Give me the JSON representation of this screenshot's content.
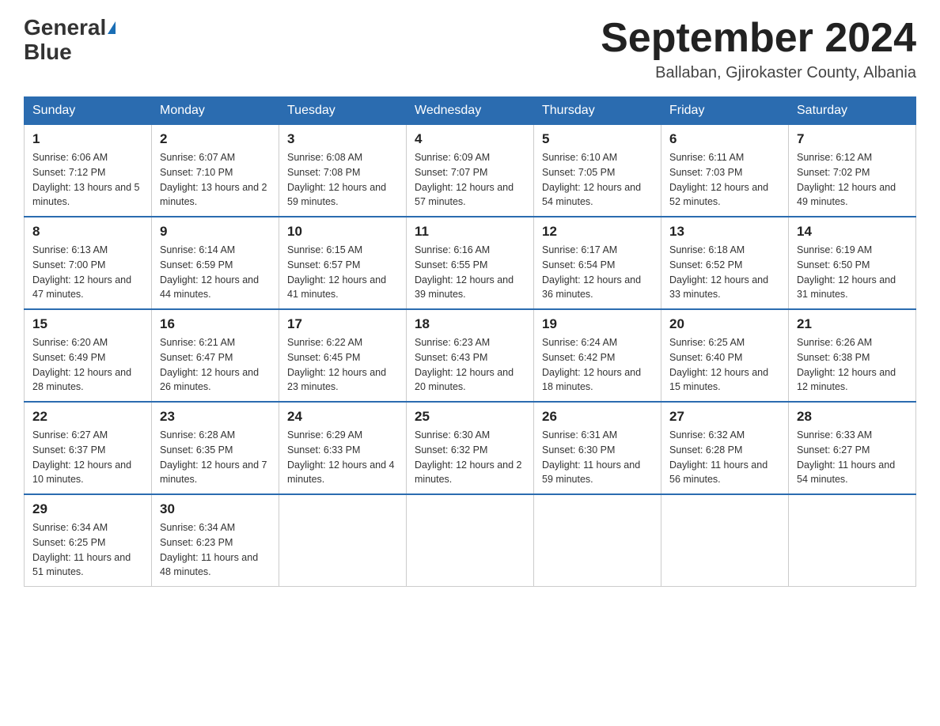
{
  "header": {
    "logo_general": "General",
    "logo_blue": "Blue",
    "title": "September 2024",
    "subtitle": "Ballaban, Gjirokaster County, Albania"
  },
  "days_of_week": [
    "Sunday",
    "Monday",
    "Tuesday",
    "Wednesday",
    "Thursday",
    "Friday",
    "Saturday"
  ],
  "weeks": [
    [
      {
        "day": "1",
        "sunrise": "6:06 AM",
        "sunset": "7:12 PM",
        "daylight": "13 hours and 5 minutes."
      },
      {
        "day": "2",
        "sunrise": "6:07 AM",
        "sunset": "7:10 PM",
        "daylight": "13 hours and 2 minutes."
      },
      {
        "day": "3",
        "sunrise": "6:08 AM",
        "sunset": "7:08 PM",
        "daylight": "12 hours and 59 minutes."
      },
      {
        "day": "4",
        "sunrise": "6:09 AM",
        "sunset": "7:07 PM",
        "daylight": "12 hours and 57 minutes."
      },
      {
        "day": "5",
        "sunrise": "6:10 AM",
        "sunset": "7:05 PM",
        "daylight": "12 hours and 54 minutes."
      },
      {
        "day": "6",
        "sunrise": "6:11 AM",
        "sunset": "7:03 PM",
        "daylight": "12 hours and 52 minutes."
      },
      {
        "day": "7",
        "sunrise": "6:12 AM",
        "sunset": "7:02 PM",
        "daylight": "12 hours and 49 minutes."
      }
    ],
    [
      {
        "day": "8",
        "sunrise": "6:13 AM",
        "sunset": "7:00 PM",
        "daylight": "12 hours and 47 minutes."
      },
      {
        "day": "9",
        "sunrise": "6:14 AM",
        "sunset": "6:59 PM",
        "daylight": "12 hours and 44 minutes."
      },
      {
        "day": "10",
        "sunrise": "6:15 AM",
        "sunset": "6:57 PM",
        "daylight": "12 hours and 41 minutes."
      },
      {
        "day": "11",
        "sunrise": "6:16 AM",
        "sunset": "6:55 PM",
        "daylight": "12 hours and 39 minutes."
      },
      {
        "day": "12",
        "sunrise": "6:17 AM",
        "sunset": "6:54 PM",
        "daylight": "12 hours and 36 minutes."
      },
      {
        "day": "13",
        "sunrise": "6:18 AM",
        "sunset": "6:52 PM",
        "daylight": "12 hours and 33 minutes."
      },
      {
        "day": "14",
        "sunrise": "6:19 AM",
        "sunset": "6:50 PM",
        "daylight": "12 hours and 31 minutes."
      }
    ],
    [
      {
        "day": "15",
        "sunrise": "6:20 AM",
        "sunset": "6:49 PM",
        "daylight": "12 hours and 28 minutes."
      },
      {
        "day": "16",
        "sunrise": "6:21 AM",
        "sunset": "6:47 PM",
        "daylight": "12 hours and 26 minutes."
      },
      {
        "day": "17",
        "sunrise": "6:22 AM",
        "sunset": "6:45 PM",
        "daylight": "12 hours and 23 minutes."
      },
      {
        "day": "18",
        "sunrise": "6:23 AM",
        "sunset": "6:43 PM",
        "daylight": "12 hours and 20 minutes."
      },
      {
        "day": "19",
        "sunrise": "6:24 AM",
        "sunset": "6:42 PM",
        "daylight": "12 hours and 18 minutes."
      },
      {
        "day": "20",
        "sunrise": "6:25 AM",
        "sunset": "6:40 PM",
        "daylight": "12 hours and 15 minutes."
      },
      {
        "day": "21",
        "sunrise": "6:26 AM",
        "sunset": "6:38 PM",
        "daylight": "12 hours and 12 minutes."
      }
    ],
    [
      {
        "day": "22",
        "sunrise": "6:27 AM",
        "sunset": "6:37 PM",
        "daylight": "12 hours and 10 minutes."
      },
      {
        "day": "23",
        "sunrise": "6:28 AM",
        "sunset": "6:35 PM",
        "daylight": "12 hours and 7 minutes."
      },
      {
        "day": "24",
        "sunrise": "6:29 AM",
        "sunset": "6:33 PM",
        "daylight": "12 hours and 4 minutes."
      },
      {
        "day": "25",
        "sunrise": "6:30 AM",
        "sunset": "6:32 PM",
        "daylight": "12 hours and 2 minutes."
      },
      {
        "day": "26",
        "sunrise": "6:31 AM",
        "sunset": "6:30 PM",
        "daylight": "11 hours and 59 minutes."
      },
      {
        "day": "27",
        "sunrise": "6:32 AM",
        "sunset": "6:28 PM",
        "daylight": "11 hours and 56 minutes."
      },
      {
        "day": "28",
        "sunrise": "6:33 AM",
        "sunset": "6:27 PM",
        "daylight": "11 hours and 54 minutes."
      }
    ],
    [
      {
        "day": "29",
        "sunrise": "6:34 AM",
        "sunset": "6:25 PM",
        "daylight": "11 hours and 51 minutes."
      },
      {
        "day": "30",
        "sunrise": "6:34 AM",
        "sunset": "6:23 PM",
        "daylight": "11 hours and 48 minutes."
      },
      null,
      null,
      null,
      null,
      null
    ]
  ]
}
